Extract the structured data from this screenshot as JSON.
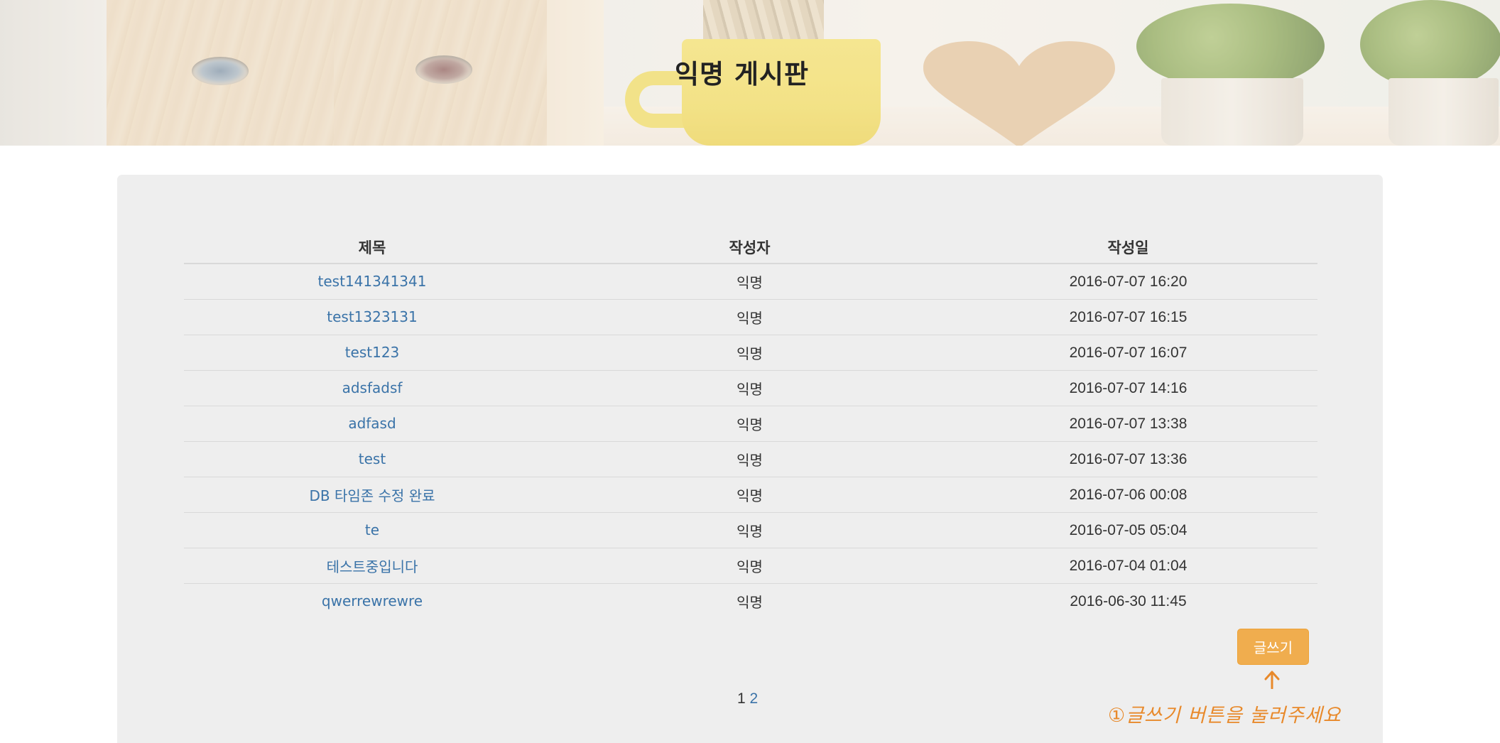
{
  "header": {
    "title": "익명 게시판"
  },
  "board": {
    "columns": [
      "제목",
      "작성자",
      "작성일"
    ],
    "rows": [
      {
        "title": "test141341341",
        "author": "익명",
        "date": "2016-07-07 16:20"
      },
      {
        "title": "test1323131",
        "author": "익명",
        "date": "2016-07-07 16:15"
      },
      {
        "title": "test123",
        "author": "익명",
        "date": "2016-07-07 16:07"
      },
      {
        "title": "adsfadsf",
        "author": "익명",
        "date": "2016-07-07 14:16"
      },
      {
        "title": "adfasd",
        "author": "익명",
        "date": "2016-07-07 13:38"
      },
      {
        "title": "test",
        "author": "익명",
        "date": "2016-07-07 13:36"
      },
      {
        "title": "DB 타임존 수정 완료",
        "author": "익명",
        "date": "2016-07-06 00:08"
      },
      {
        "title": "te",
        "author": "익명",
        "date": "2016-07-05 05:04"
      },
      {
        "title": "테스트중입니다",
        "author": "익명",
        "date": "2016-07-04 01:04"
      },
      {
        "title": "qwerrewrewre",
        "author": "익명",
        "date": "2016-06-30 11:45"
      }
    ]
  },
  "actions": {
    "write_label": "글쓰기"
  },
  "pagination": {
    "current": "1",
    "pages": [
      "2"
    ]
  },
  "annotation": {
    "hint": "①글쓰기 버튼을 눌러주세요"
  },
  "colors": {
    "panel_bg": "#eeeeee",
    "link": "#3a73a8",
    "button": "#f0ad4e",
    "annotation": "#e8892a"
  }
}
